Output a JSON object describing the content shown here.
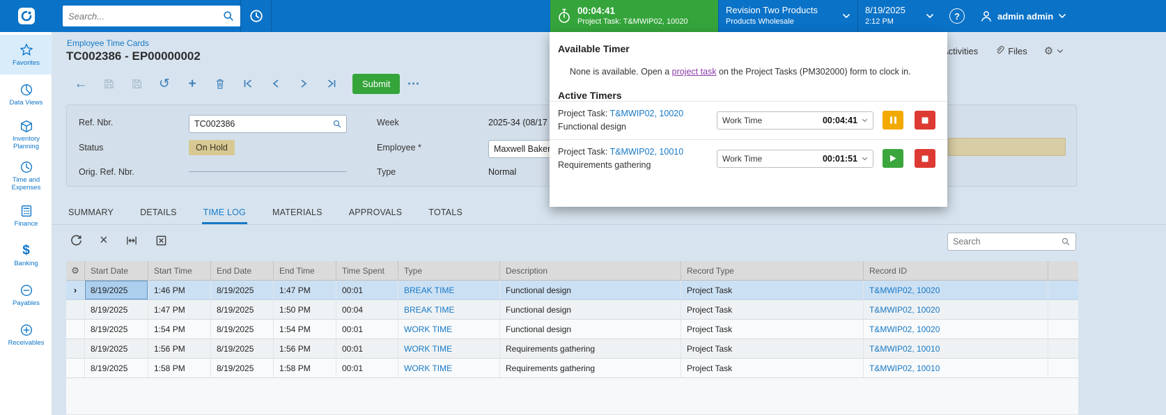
{
  "colors": {
    "topbar_blue": "#0A72C7",
    "green": "#35A43B",
    "red": "#DC3A32",
    "amber": "#F2A900",
    "link_blue": "#1779C6",
    "status_tan": "#D8C994"
  },
  "glyphs": {
    "gear": "⚙",
    "more": "⋯",
    "back": "←",
    "undo": "↺",
    "plus": "+",
    "close": "×",
    "dollar": "$",
    "question": "?"
  },
  "topbar": {
    "search_placeholder": "Search...",
    "timer_widget": {
      "time": "00:04:41",
      "task": "Project Task: T&MWIP02, 10020"
    },
    "company": {
      "name": "Revision Two Products",
      "branch": "Products Wholesale"
    },
    "clock": {
      "date": "8/19/2025",
      "time": "2:12 PM"
    },
    "user_name": "admin admin"
  },
  "sidebar": {
    "items": [
      {
        "label": "Favorites"
      },
      {
        "label": "Data Views"
      },
      {
        "label": "Inventory Planning"
      },
      {
        "label": "Time and Expenses"
      },
      {
        "label": "Finance"
      },
      {
        "label": "Banking"
      },
      {
        "label": "Payables"
      },
      {
        "label": "Receivables"
      }
    ]
  },
  "header": {
    "breadcrumb": "Employee Time Cards",
    "title": "TC002386 - EP00000002",
    "activities_label": "Activities",
    "files_label": "Files"
  },
  "record_toolbar": {
    "submit_label": "Submit"
  },
  "form": {
    "ref_nbr": {
      "label": "Ref. Nbr.",
      "value": "TC002386"
    },
    "status": {
      "label": "Status",
      "value": "On Hold"
    },
    "orig_ref": {
      "label": "Orig. Ref. Nbr.",
      "value": ""
    },
    "week": {
      "label": "Week",
      "value": "2025-34 (08/17"
    },
    "employee": {
      "label": "Employee *",
      "value": "Maxwell Baker"
    },
    "type": {
      "label": "Type",
      "value": "Normal"
    }
  },
  "tabs": {
    "items": [
      {
        "label": "SUMMARY"
      },
      {
        "label": "DETAILS"
      },
      {
        "label": "TIME LOG"
      },
      {
        "label": "MATERIALS"
      },
      {
        "label": "APPROVALS"
      },
      {
        "label": "TOTALS"
      }
    ]
  },
  "grid": {
    "search_placeholder": "Search",
    "headers": [
      "Start Date",
      "Start Time",
      "End Date",
      "End Time",
      "Time Spent",
      "Type",
      "Description",
      "Record Type",
      "Record ID"
    ],
    "rows": [
      {
        "start_date": "8/19/2025",
        "start_time": "1:46 PM",
        "end_date": "8/19/2025",
        "end_time": "1:47 PM",
        "time_spent": "00:01",
        "type": "BREAK TIME",
        "description": "Functional design",
        "record_type": "Project Task",
        "record_id": "T&MWIP02, 10020"
      },
      {
        "start_date": "8/19/2025",
        "start_time": "1:47 PM",
        "end_date": "8/19/2025",
        "end_time": "1:50 PM",
        "time_spent": "00:04",
        "type": "BREAK TIME",
        "description": "Functional design",
        "record_type": "Project Task",
        "record_id": "T&MWIP02, 10020"
      },
      {
        "start_date": "8/19/2025",
        "start_time": "1:54 PM",
        "end_date": "8/19/2025",
        "end_time": "1:54 PM",
        "time_spent": "00:01",
        "type": "WORK TIME",
        "description": "Functional design",
        "record_type": "Project Task",
        "record_id": "T&MWIP02, 10020"
      },
      {
        "start_date": "8/19/2025",
        "start_time": "1:56 PM",
        "end_date": "8/19/2025",
        "end_time": "1:56 PM",
        "time_spent": "00:01",
        "type": "WORK TIME",
        "description": "Requirements gathering",
        "record_type": "Project Task",
        "record_id": "T&MWIP02, 10010"
      },
      {
        "start_date": "8/19/2025",
        "start_time": "1:58 PM",
        "end_date": "8/19/2025",
        "end_time": "1:58 PM",
        "time_spent": "00:01",
        "type": "WORK TIME",
        "description": "Requirements gathering",
        "record_type": "Project Task",
        "record_id": "T&MWIP02, 10010"
      }
    ]
  },
  "timer_panel": {
    "available_title": "Available Timer",
    "note_pre": "None is available. Open a ",
    "note_link": "project task",
    "note_post": " on the Project Tasks (PM302000) form to clock in.",
    "active_title": "Active Timers",
    "timers": [
      {
        "task_prefix": "Project Task: ",
        "task_link": "T&MWIP02, 10020",
        "description": "Functional design",
        "mode": "Work Time",
        "elapsed": "00:04:41"
      },
      {
        "task_prefix": "Project Task: ",
        "task_link": "T&MWIP02, 10010",
        "description": "Requirements gathering",
        "mode": "Work Time",
        "elapsed": "00:01:51"
      }
    ]
  }
}
